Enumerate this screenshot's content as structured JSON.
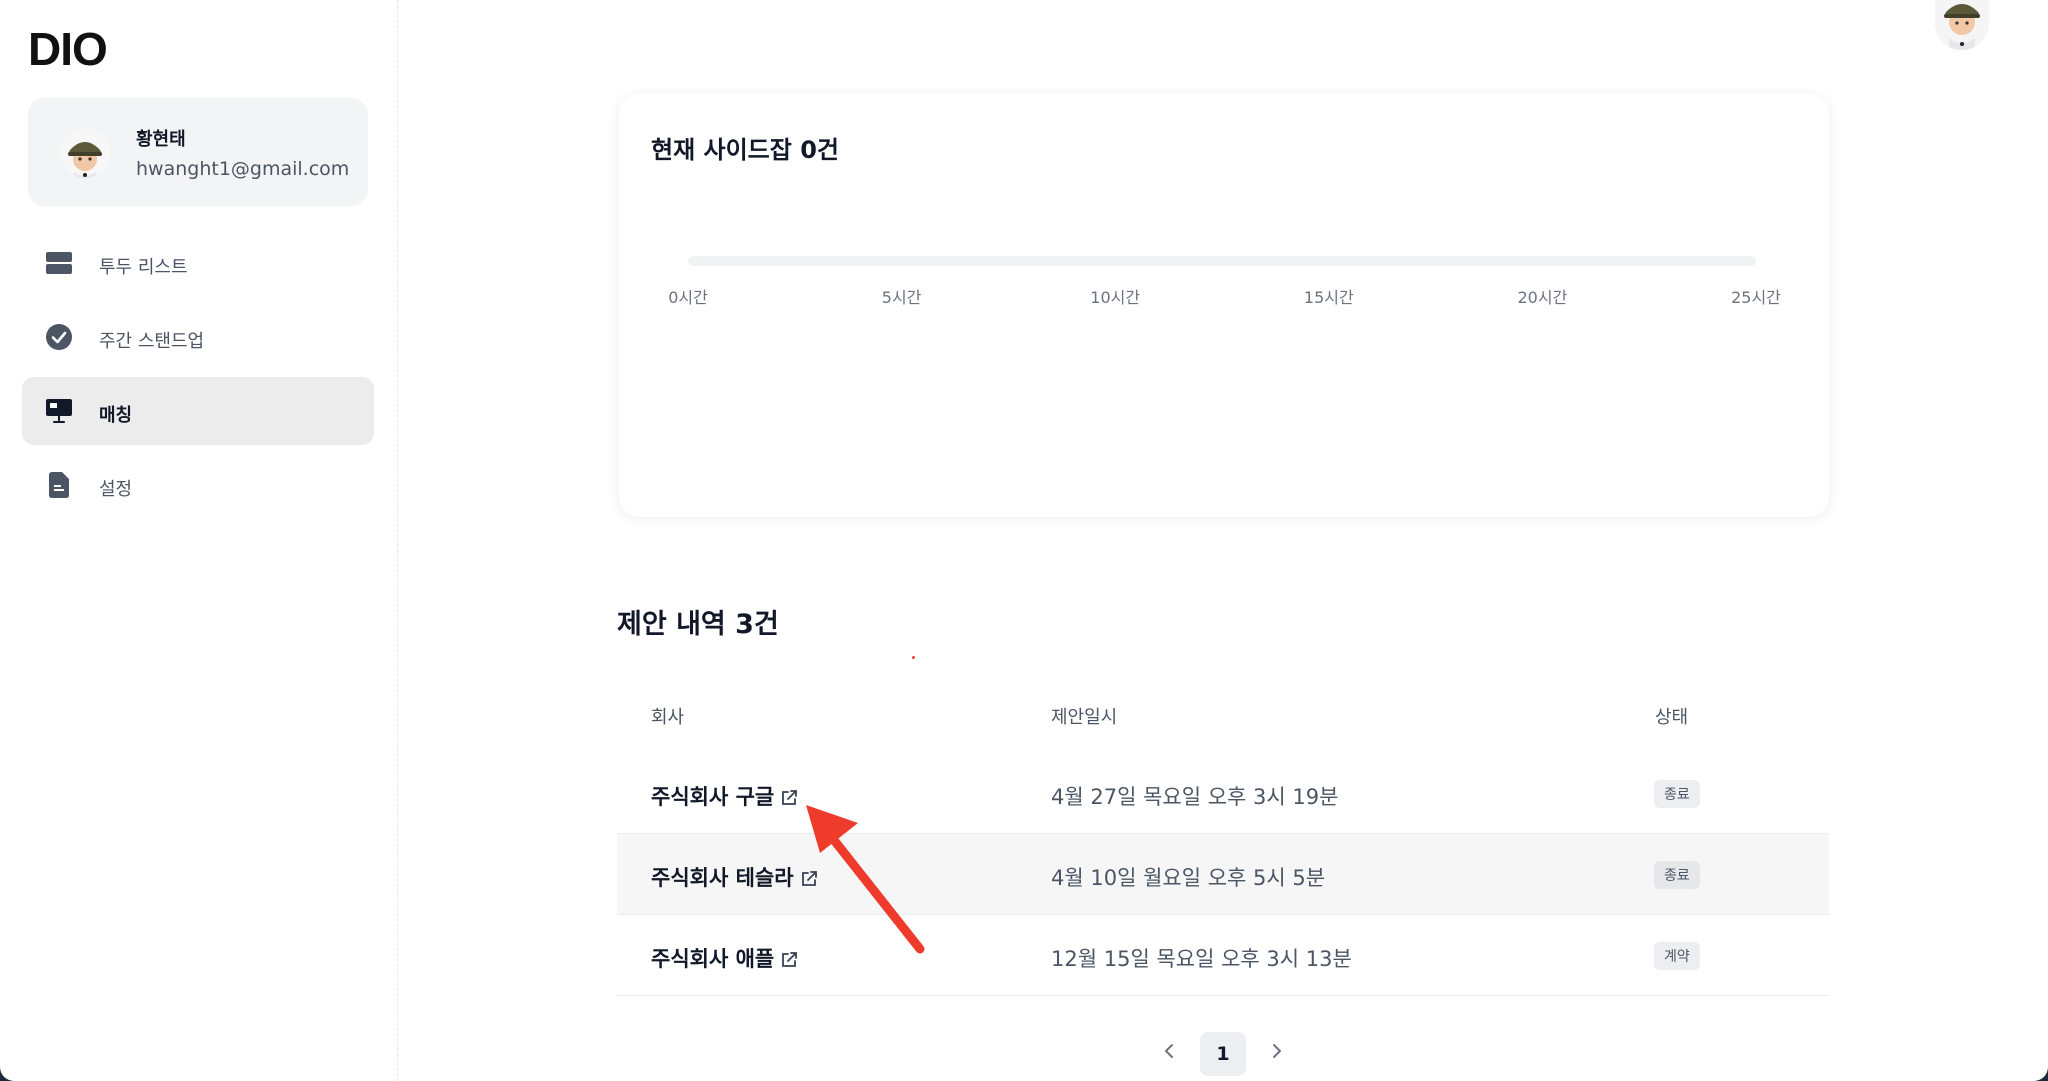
{
  "brand": {
    "logo": "DIO"
  },
  "profile": {
    "name": "황현태",
    "email": "hwanght1@gmail.com"
  },
  "sidebar": {
    "items": [
      {
        "label": "투두 리스트",
        "icon": "list-icon",
        "active": false
      },
      {
        "label": "주간 스탠드업",
        "icon": "check-circle-icon",
        "active": false
      },
      {
        "label": "매칭",
        "icon": "monitor-icon",
        "active": true
      },
      {
        "label": "설정",
        "icon": "document-icon",
        "active": false
      }
    ]
  },
  "chart": {
    "title": "현재 사이드잡 0건"
  },
  "chart_data": {
    "type": "bar",
    "orientation": "horizontal",
    "title": "현재 사이드잡 0건",
    "xlim": [
      0,
      25
    ],
    "tick_labels": [
      "0시간",
      "5시간",
      "10시간",
      "15시간",
      "20시간",
      "25시간"
    ],
    "ticks": [
      0,
      5,
      10,
      15,
      20,
      25
    ],
    "values": [
      0
    ]
  },
  "proposals": {
    "title": "제안 내역 3건",
    "headers": {
      "company": "회사",
      "date": "제안일시",
      "status": "상태"
    },
    "rows": [
      {
        "company": "주식회사 구글",
        "date": "4월 27일 목요일 오후 3시 19분",
        "status": "종료"
      },
      {
        "company": "주식회사 테슬라",
        "date": "4월 10일 월요일 오후 5시 5분",
        "status": "종료"
      },
      {
        "company": "주식회사 애플",
        "date": "12월 15일 목요일 오후 3시 13분",
        "status": "계약"
      }
    ]
  },
  "pagination": {
    "current": "1"
  },
  "colors": {
    "annotation_arrow": "#ef3b2c",
    "active_nav_bg": "#ececec",
    "badge_bg": "#eceef1"
  }
}
